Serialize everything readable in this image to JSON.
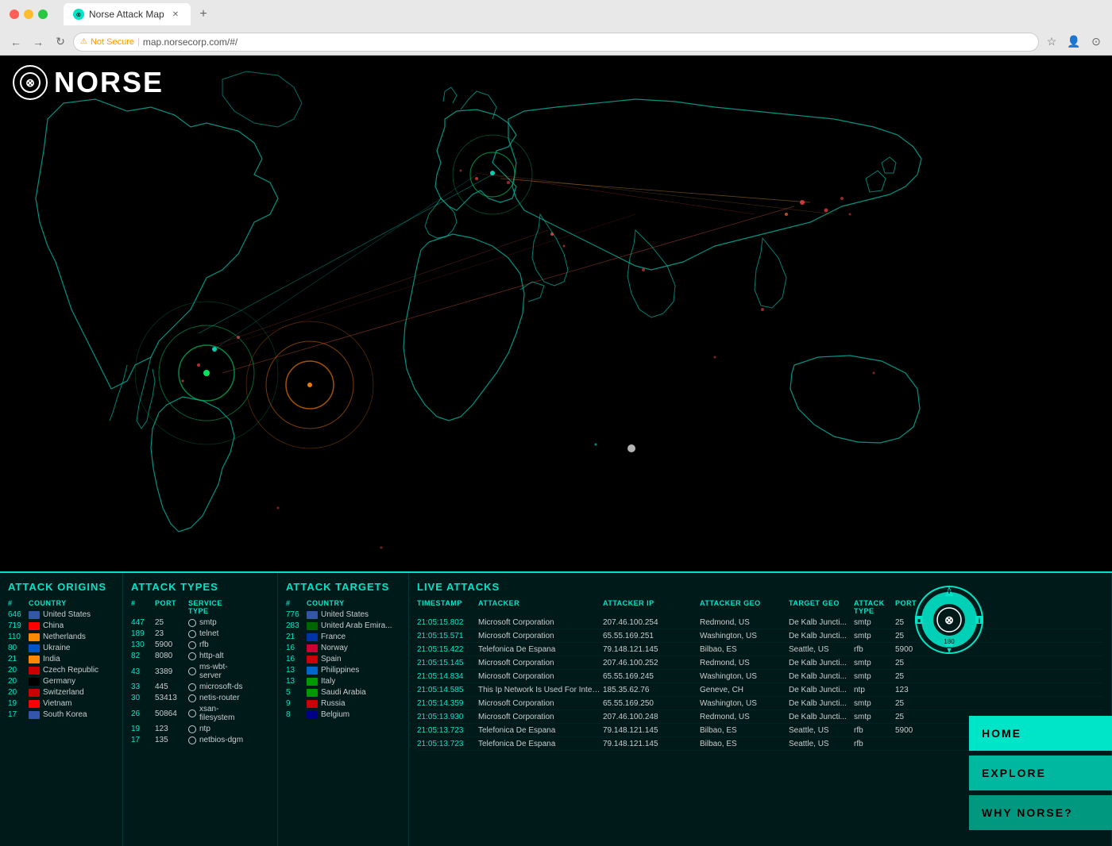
{
  "browser": {
    "title": "Norse Attack Map",
    "url": "map.norsecorp.com/#/",
    "security": "Not Secure",
    "favicon": "⊗"
  },
  "logo": {
    "text": "NORSE"
  },
  "sections": {
    "origins": {
      "title": "ATTACK ORIGINS",
      "col_country": "COUNTRY",
      "rows": [
        {
          "count": "646",
          "flag_color": "#3355aa",
          "country": "United States",
          "num": ""
        },
        {
          "count": "719",
          "flag_color": "#ff0000",
          "country": "China",
          "num": ""
        },
        {
          "count": "110",
          "flag_color": "#ff8800",
          "country": "Netherlands",
          "num": ""
        },
        {
          "count": "80",
          "flag_color": "#0055cc",
          "country": "Ukraine",
          "num": ""
        },
        {
          "count": "21",
          "flag_color": "#ff8800",
          "country": "India",
          "num": ""
        },
        {
          "count": "20",
          "flag_color": "#cc0000",
          "country": "Czech Republic",
          "num": ""
        },
        {
          "count": "20",
          "flag_color": "#000000",
          "country": "Germany",
          "num": ""
        },
        {
          "count": "20",
          "flag_color": "#cc0000",
          "country": "Switzerland",
          "num": ""
        },
        {
          "count": "19",
          "flag_color": "#ff0000",
          "country": "Vietnam",
          "num": ""
        },
        {
          "count": "17",
          "flag_color": "#3355aa",
          "country": "South Korea",
          "num": ""
        }
      ]
    },
    "types": {
      "title": "ATTACK TYPES",
      "cols": [
        "#",
        "PORT",
        "SERVICE TYPE"
      ],
      "rows": [
        {
          "num": "447",
          "port": "25",
          "icon_color": "#ccc",
          "service": "smtp"
        },
        {
          "num": "189",
          "port": "23",
          "icon_color": "#ccc",
          "service": "telnet"
        },
        {
          "num": "130",
          "port": "5900",
          "icon_color": "#ccc",
          "service": "rfb"
        },
        {
          "num": "82",
          "port": "8080",
          "icon_color": "#ccc",
          "service": "http-alt"
        },
        {
          "num": "43",
          "port": "3389",
          "icon_color": "#ccc",
          "service": "ms-wbt-server"
        },
        {
          "num": "33",
          "port": "445",
          "icon_color": "#ccc",
          "service": "microsoft-ds"
        },
        {
          "num": "30",
          "port": "53413",
          "icon_color": "#ccc",
          "service": "netis-router"
        },
        {
          "num": "26",
          "port": "50864",
          "icon_color": "#ccc",
          "service": "xsan-filesystem"
        },
        {
          "num": "19",
          "port": "123",
          "icon_color": "#ccc",
          "service": "ntp"
        },
        {
          "num": "17",
          "port": "135",
          "icon_color": "#ccc",
          "service": "netbios-dgm"
        }
      ]
    },
    "targets": {
      "title": "ATTACK TARGETS",
      "col_country": "COUNTRY",
      "rows": [
        {
          "count": "776",
          "flag_color": "#3355aa",
          "country": "United States"
        },
        {
          "count": "283",
          "flag_color": "#006600",
          "country": "United Arab Emira..."
        },
        {
          "count": "21",
          "flag_color": "#0033aa",
          "country": "France"
        },
        {
          "count": "16",
          "flag_color": "#cc0033",
          "country": "Norway"
        },
        {
          "count": "16",
          "flag_color": "#cc0000",
          "country": "Spain"
        },
        {
          "count": "13",
          "flag_color": "#0066cc",
          "country": "Philippines"
        },
        {
          "count": "13",
          "flag_color": "#009900",
          "country": "Italy"
        },
        {
          "count": "5",
          "flag_color": "#009900",
          "country": "Saudi Arabia"
        },
        {
          "count": "9",
          "flag_color": "#cc0000",
          "country": "Russia"
        },
        {
          "count": "8",
          "flag_color": "#000088",
          "country": "Belgium"
        }
      ]
    },
    "live": {
      "title": "LIVE ATTACKS",
      "cols": [
        "TIMESTAMP",
        "ATTACKER",
        "ATTACKER IP",
        "ATTACKER GEO",
        "TARGET GEO",
        "ATTACK TYPE",
        "PORT"
      ],
      "rows": [
        {
          "ts": "21:05:15.802",
          "attacker": "Microsoft Corporation",
          "ip": "207.46.100.254",
          "ageo": "Redmond, US",
          "tgeo": "De Kalb Juncti...",
          "type": "smtp",
          "port": "25"
        },
        {
          "ts": "21:05:15.571",
          "attacker": "Microsoft Corporation",
          "ip": "65.55.169.251",
          "ageo": "Washington, US",
          "tgeo": "De Kalb Juncti...",
          "type": "smtp",
          "port": "25"
        },
        {
          "ts": "21:05:15.422",
          "attacker": "Telefonica De Espana",
          "ip": "79.148.121.145",
          "ageo": "Bilbao, ES",
          "tgeo": "Seattle, US",
          "type": "rfb",
          "port": "5900"
        },
        {
          "ts": "21:05:15.145",
          "attacker": "Microsoft Corporation",
          "ip": "207.46.100.252",
          "ageo": "Redmond, US",
          "tgeo": "De Kalb Juncti...",
          "type": "smtp",
          "port": "25"
        },
        {
          "ts": "21:05:14.834",
          "attacker": "Microsoft Corporation",
          "ip": "65.55.169.245",
          "ageo": "Washington, US",
          "tgeo": "De Kalb Juncti...",
          "type": "smtp",
          "port": "25"
        },
        {
          "ts": "21:05:14.585",
          "attacker": "This Ip Network Is Used For Internet Security ...",
          "ip": "185.35.62.76",
          "ageo": "Geneve, CH",
          "tgeo": "De Kalb Juncti...",
          "type": "ntp",
          "port": "123"
        },
        {
          "ts": "21:05:14.359",
          "attacker": "Microsoft Corporation",
          "ip": "65.55.169.250",
          "ageo": "Washington, US",
          "tgeo": "De Kalb Juncti...",
          "type": "smtp",
          "port": "25"
        },
        {
          "ts": "21:05:13.930",
          "attacker": "Microsoft Corporation",
          "ip": "207.46.100.248",
          "ageo": "Redmond, US",
          "tgeo": "De Kalb Juncti...",
          "type": "smtp",
          "port": "25"
        },
        {
          "ts": "21:05:13.723",
          "attacker": "Telefonica De Espana",
          "ip": "79.148.121.145",
          "ageo": "Bilbao, ES",
          "tgeo": "Seattle, US",
          "type": "rfb",
          "port": "5900"
        },
        {
          "ts": "21:05:13.723",
          "attacker": "Telefonica De Espana",
          "ip": "79.148.121.145",
          "ageo": "Bilbao, ES",
          "tgeo": "Seattle, US",
          "type": "rfb",
          "port": ""
        }
      ]
    }
  },
  "nav": {
    "home": "HOME",
    "explore": "EXPLORE",
    "why": "WHY NORSE?"
  }
}
